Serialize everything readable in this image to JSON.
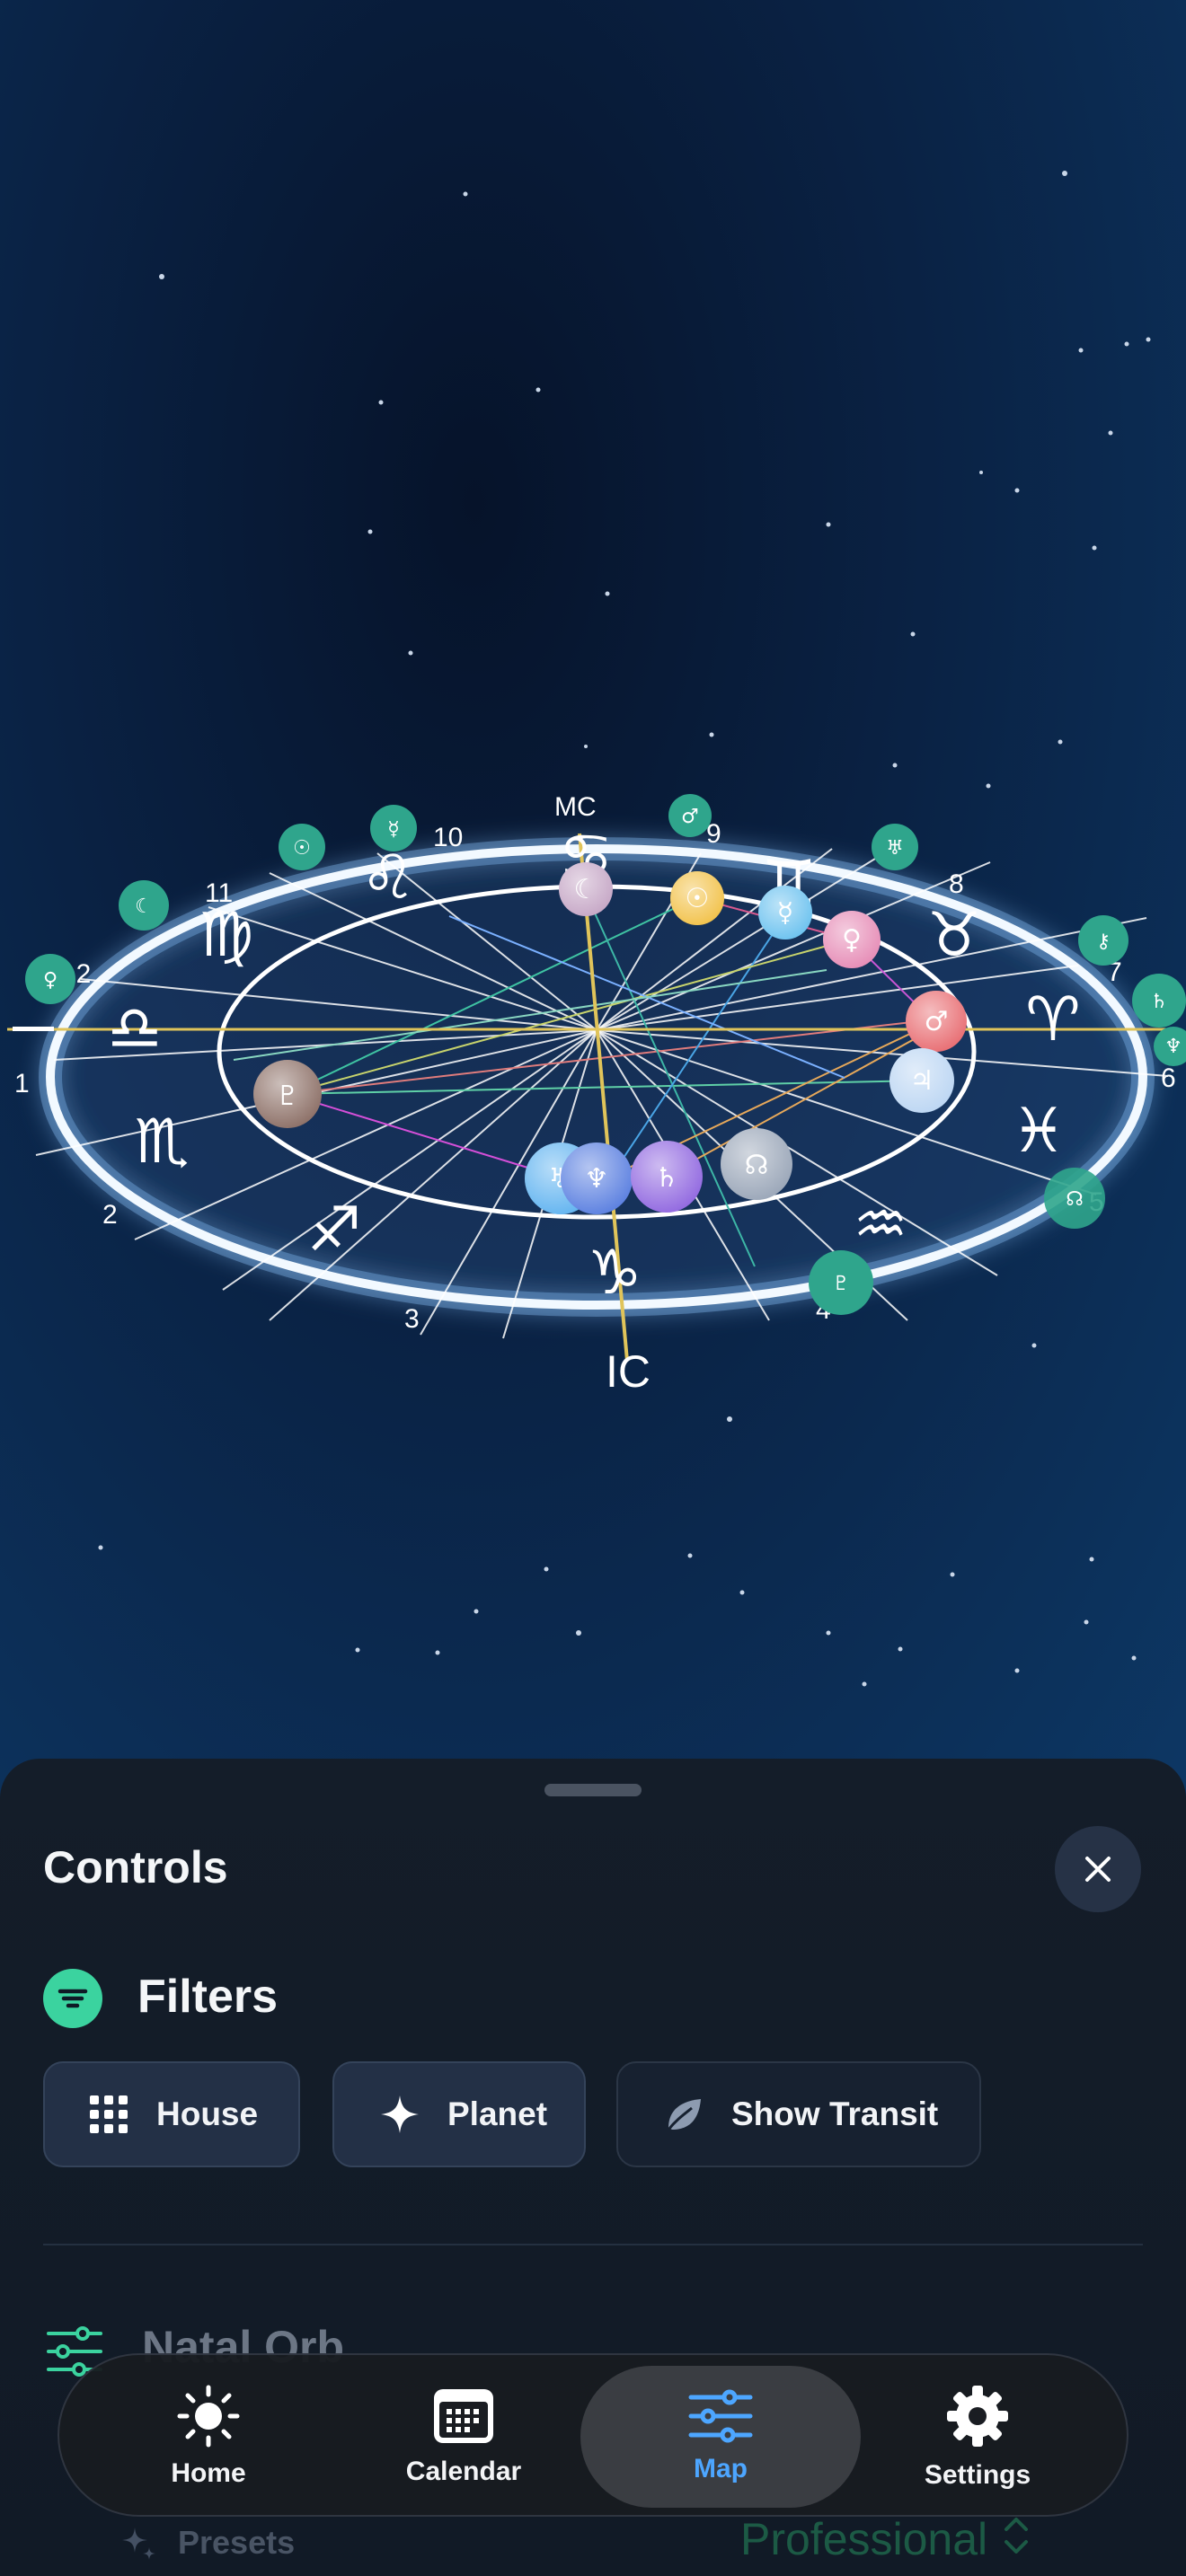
{
  "chart_wheel": {
    "mc_label": "MC",
    "ic_label": "IC",
    "house_numbers": [
      "1",
      "2",
      "3",
      "4",
      "5",
      "6",
      "7",
      "8",
      "9",
      "10",
      "11",
      "12"
    ],
    "zodiac_glyphs": [
      "♎",
      "♏",
      "♐",
      "♑",
      "♒",
      "♓",
      "♈",
      "♉",
      "♊",
      "♋",
      "♌",
      "♍"
    ],
    "planet_glyphs": {
      "saturn": "♄",
      "uranus": "♅",
      "neptune": "♆",
      "node": "☊",
      "pluto": "♇",
      "sun": "☉",
      "moon": "☾",
      "mars": "♂",
      "venus": "♀",
      "mercury": "☿",
      "jupiter": "♃",
      "chiron": "⚷"
    },
    "colors": {
      "ring_glow": "#cfe8ff",
      "transit_marker": "#2fa58c",
      "horizon_line": "#e0c45a"
    }
  },
  "controls": {
    "title": "Controls",
    "filters_label": "Filters",
    "chips": [
      {
        "label": "House",
        "icon": "grid-icon",
        "active": true
      },
      {
        "label": "Planet",
        "icon": "sparkle-icon",
        "active": true
      },
      {
        "label": "Show Transit",
        "icon": "leaf-icon",
        "active": false
      }
    ],
    "natal_orb_label": "Natal Orb",
    "presets_label": "Presets",
    "preset_value": "Professional"
  },
  "nav": {
    "items": [
      {
        "label": "Home",
        "icon": "sun-icon",
        "active": false
      },
      {
        "label": "Calendar",
        "icon": "calendar-icon",
        "active": false
      },
      {
        "label": "Map",
        "icon": "sliders-icon",
        "active": true
      },
      {
        "label": "Settings",
        "icon": "gear-icon",
        "active": false
      }
    ],
    "accent": "#4da6ff"
  }
}
